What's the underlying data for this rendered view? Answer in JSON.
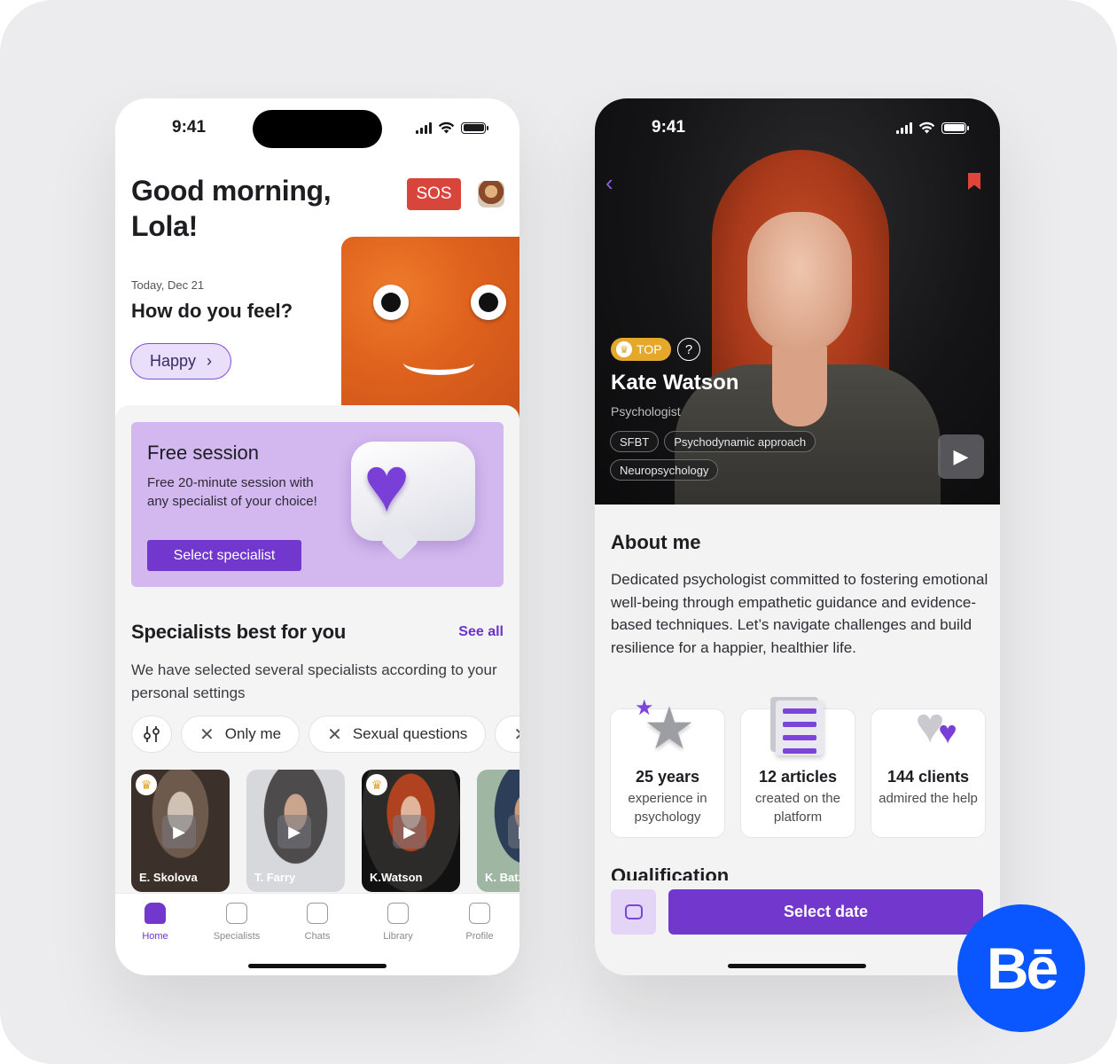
{
  "screen1": {
    "status": {
      "time": "9:41"
    },
    "greeting": "Good morning,\nLola!",
    "sos_label": "SOS",
    "date": "Today, Dec 21",
    "question": "How do you feel?",
    "mood_label": "Happy",
    "promo": {
      "title": "Free session",
      "description": "Free 20-minute session with any specialist of your choice!",
      "button": "Select specialist"
    },
    "specialists": {
      "title": "Specialists best for you",
      "see_all": "See all",
      "description": "We have selected several specialists according to your personal settings",
      "filters": [
        "Only me",
        "Sexual questions",
        ""
      ],
      "cards": [
        {
          "name": "E. Skolova",
          "top": true
        },
        {
          "name": "T. Farry",
          "top": false
        },
        {
          "name": "K.Watson",
          "top": true
        },
        {
          "name": "K. Batz",
          "top": false
        }
      ]
    },
    "tabs": [
      {
        "label": "Home",
        "active": true
      },
      {
        "label": "Specialists",
        "active": false
      },
      {
        "label": "Chats",
        "active": false
      },
      {
        "label": "Library",
        "active": false
      },
      {
        "label": "Profile",
        "active": false
      }
    ]
  },
  "screen2": {
    "status": {
      "time": "9:41"
    },
    "badge": "TOP",
    "name": "Kate Watson",
    "role": "Psychologist",
    "tags": [
      "SFBT",
      "Psychodynamic approach",
      "Neuropsychology"
    ],
    "about_title": "About me",
    "about_text": "Dedicated psychologist committed to fostering emotional well-being through empathetic guidance and evidence-based techniques. Let’s navigate challenges and build resilience for a happier, healthier life.",
    "stats": [
      {
        "value": "25 years",
        "label": "experience in psychology"
      },
      {
        "value": "12 articles",
        "label": "created on the platform"
      },
      {
        "value": "144 clients",
        "label": "admired the help"
      }
    ],
    "next_section": "Qualification",
    "cta": "Select date"
  },
  "brand": {
    "logo_text": "Bē"
  },
  "colors": {
    "accent": "#7237cc",
    "sos": "#d8453b",
    "top_badge": "#e6a82b",
    "behance": "#0a57ff"
  }
}
